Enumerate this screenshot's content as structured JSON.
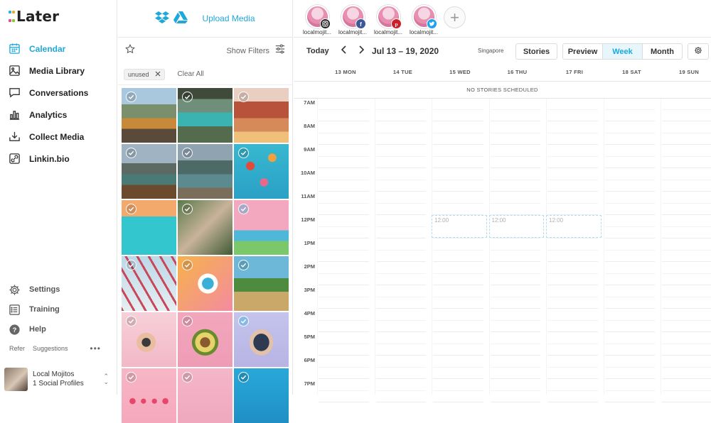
{
  "app": {
    "logo": "Later",
    "logo_dot_colors": [
      "#2bb3e5",
      "#e84e8a",
      "#f5a623",
      "#7ed321"
    ]
  },
  "sidebar": {
    "items": [
      {
        "label": "Calendar",
        "icon": "calendar-icon",
        "active": true
      },
      {
        "label": "Media Library",
        "icon": "media-library-icon",
        "active": false
      },
      {
        "label": "Conversations",
        "icon": "conversations-icon",
        "active": false
      },
      {
        "label": "Analytics",
        "icon": "analytics-icon",
        "active": false
      },
      {
        "label": "Collect Media",
        "icon": "collect-media-icon",
        "active": false
      },
      {
        "label": "Linkin.bio",
        "icon": "linkin-bio-icon",
        "active": false
      }
    ],
    "bottom_items": [
      {
        "label": "Settings",
        "icon": "settings-icon"
      },
      {
        "label": "Training",
        "icon": "training-icon"
      },
      {
        "label": "Help",
        "icon": "help-icon"
      }
    ],
    "refer": "Refer",
    "suggestions": "Suggestions",
    "more": "•••",
    "profile": {
      "name": "Local Mojitos",
      "subtitle": "1 Social Profiles"
    }
  },
  "media_panel": {
    "upload_label": "Upload Media",
    "show_filters": "Show Filters",
    "tag": "unused",
    "clear_all": "Clear All",
    "thumbnails": [
      "mountains-hiker",
      "canyon-river",
      "red-rocks-car",
      "lake-boat",
      "lake-dock",
      "hot-air-balloons",
      "pool-swimmer",
      "cactus-tropical",
      "pink-wall-car",
      "ferris-wheel",
      "phone-on-yellow",
      "palm-trees",
      "pink-hand-phone",
      "avocado",
      "phone-case",
      "pink-hearts",
      "pink-flat",
      "teal-blue"
    ]
  },
  "calendar": {
    "profiles": [
      {
        "name": "localmojit...",
        "network": "instagram",
        "badge_color": "#222222"
      },
      {
        "name": "localmojit...",
        "network": "facebook",
        "badge_color": "#3b5998"
      },
      {
        "name": "localmojit...",
        "network": "pinterest",
        "badge_color": "#cb2027"
      },
      {
        "name": "localmojit...",
        "network": "twitter",
        "badge_color": "#1da1f2"
      }
    ],
    "add_profile": "+",
    "today": "Today",
    "prev": "‹",
    "next": "›",
    "date_range": "Jul 13 – 19, 2020",
    "timezone": "Singapore",
    "stories_btn": "Stories",
    "views": [
      "Preview",
      "Week",
      "Month"
    ],
    "active_view": "Week",
    "days": [
      "13 MON",
      "14 TUE",
      "15 WED",
      "16 THU",
      "17 FRI",
      "18 SAT",
      "19 SUN"
    ],
    "no_stories": "NO STORIES SCHEDULED",
    "hours": [
      "7AM",
      "8AM",
      "9AM",
      "10AM",
      "11AM",
      "12PM",
      "1PM",
      "2PM",
      "3PM",
      "4PM",
      "5PM",
      "6PM",
      "7PM"
    ],
    "slots": [
      {
        "day_index": 2,
        "time": "12:00"
      },
      {
        "day_index": 3,
        "time": "12:00"
      },
      {
        "day_index": 4,
        "time": "12:00"
      }
    ],
    "accent": "#1fa8d9"
  }
}
